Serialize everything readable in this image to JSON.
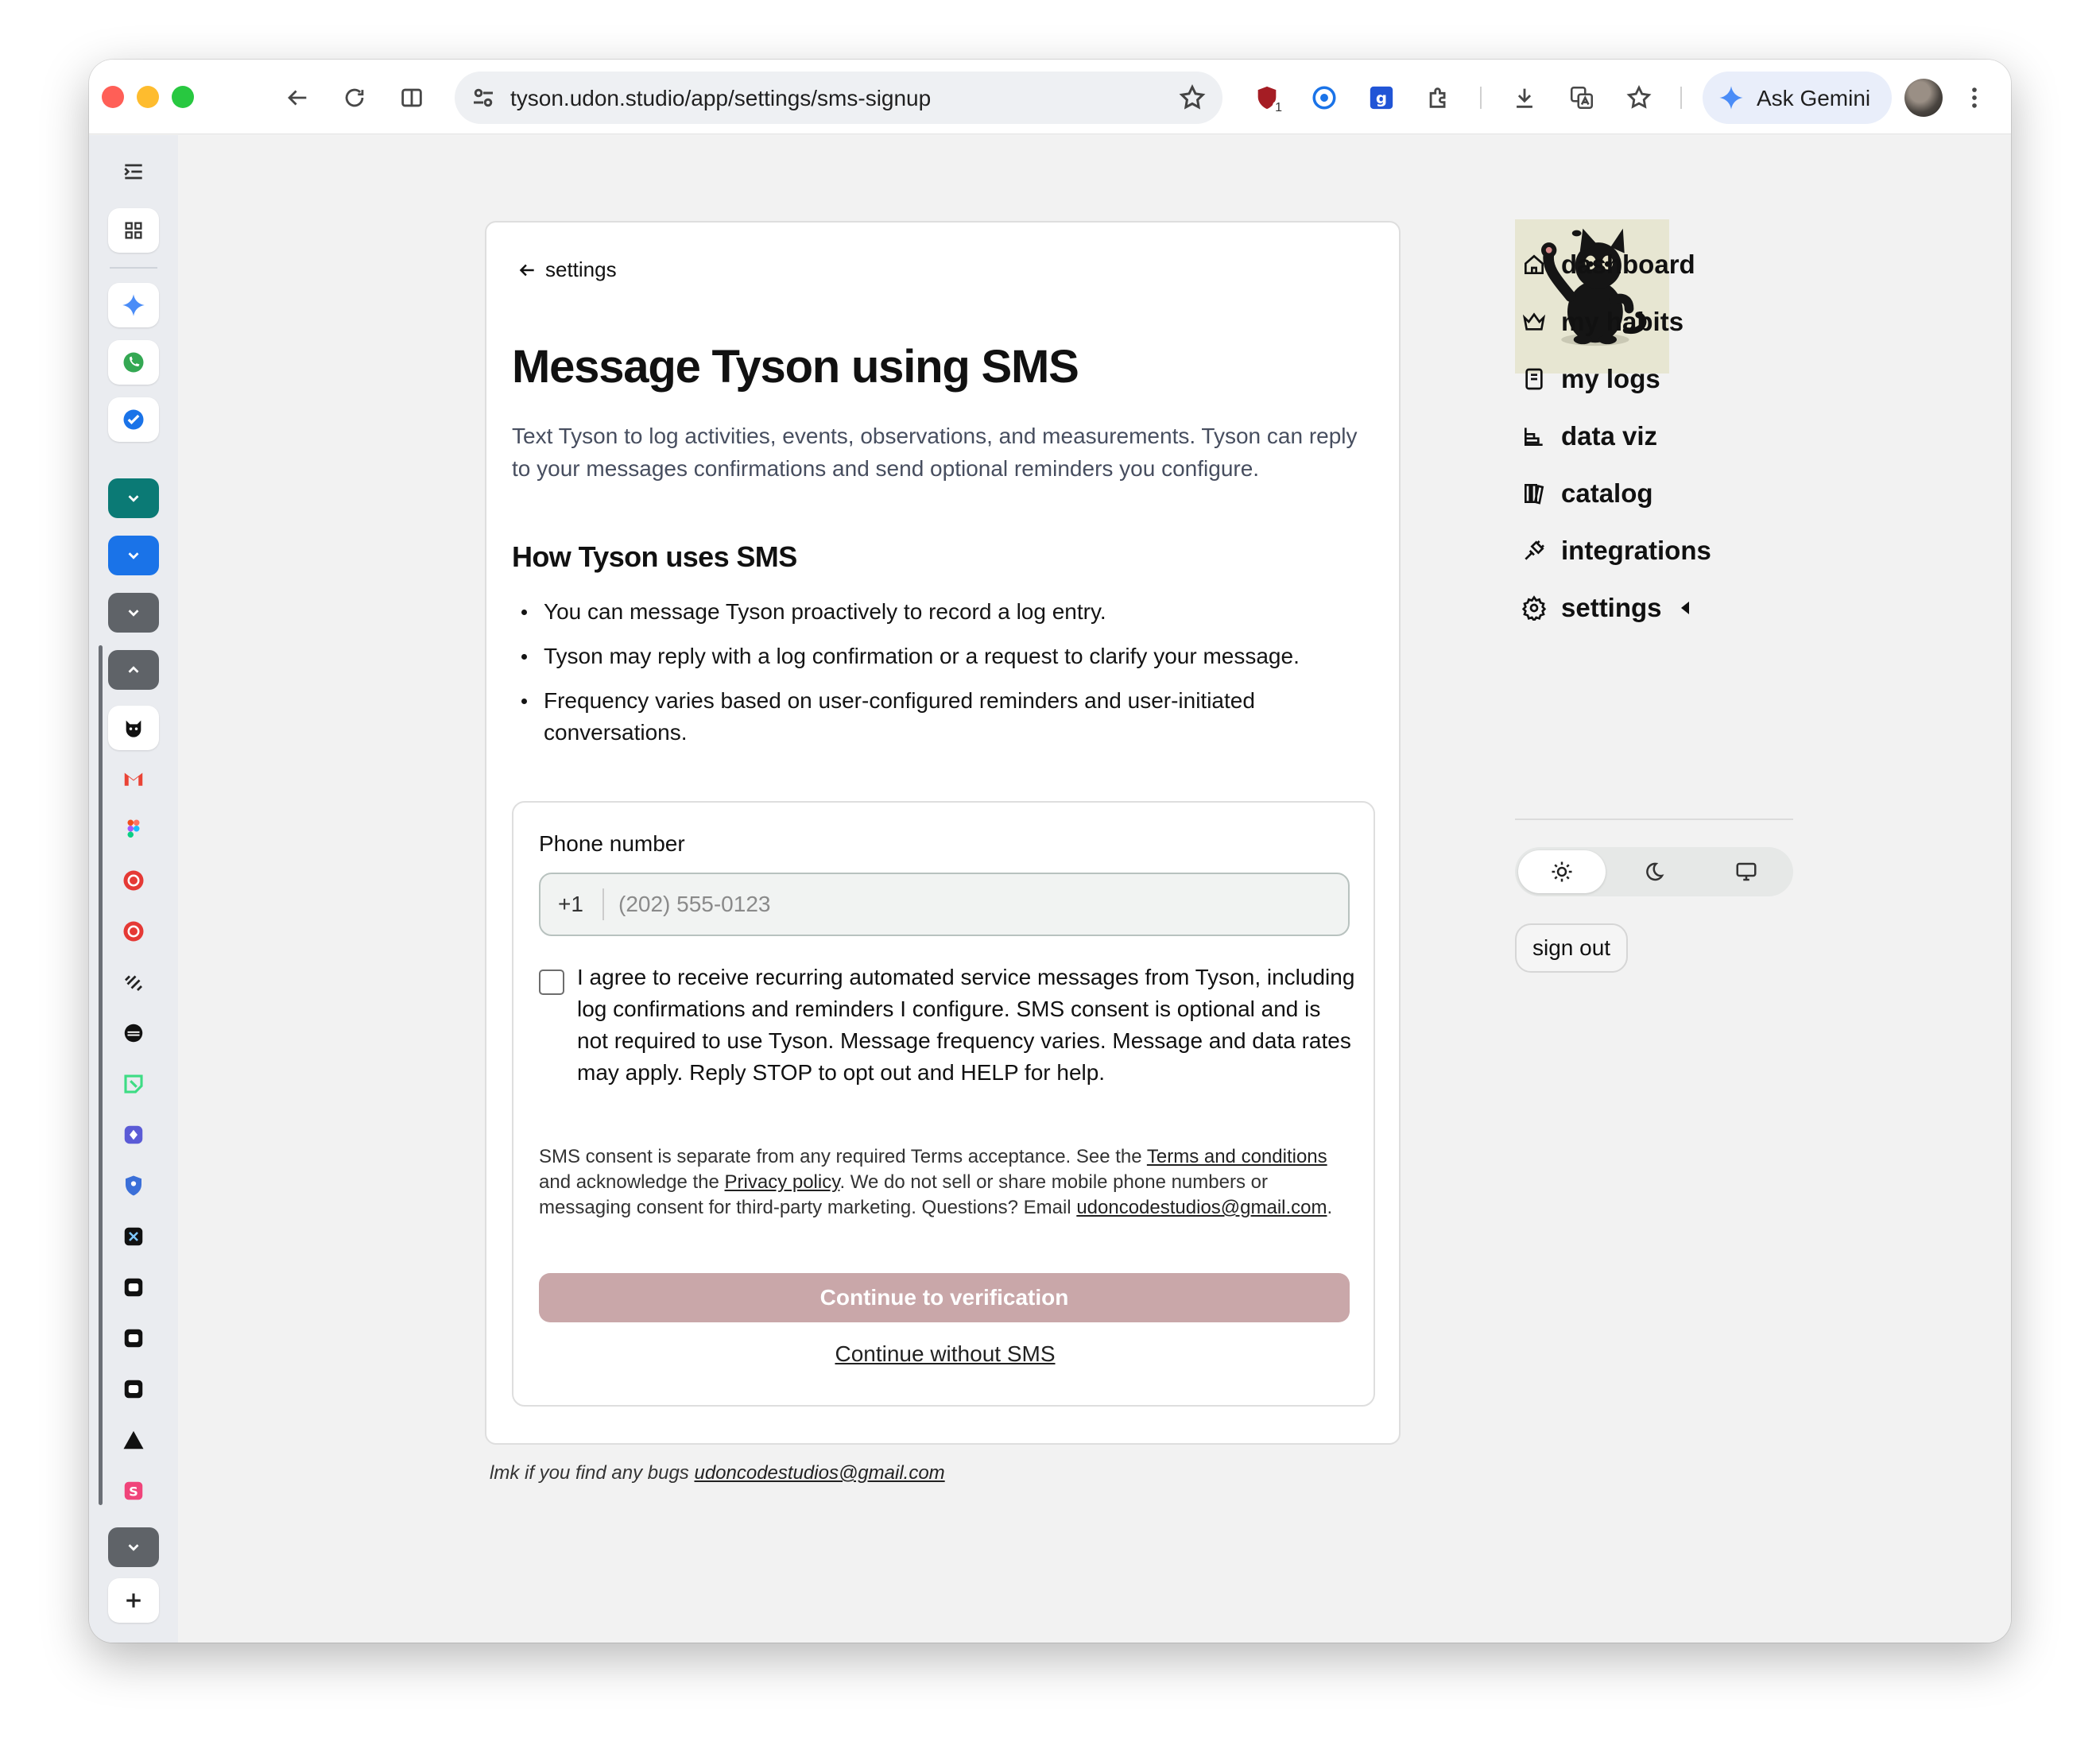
{
  "browser": {
    "url": "tyson.udon.studio/app/settings/sms-signup",
    "gemini_label": "Ask Gemini",
    "extension_badge": "1"
  },
  "page": {
    "back_label": "settings",
    "title": "Message Tyson using SMS",
    "intro": "Text Tyson to log activities, events, observations, and measurements. Tyson can reply to your messages confirmations and send optional reminders you configure.",
    "section_title": "How Tyson uses SMS",
    "bullets": [
      "You can message Tyson proactively to record a log entry.",
      "Tyson may reply with a log confirmation or a request to clarify your message.",
      "Frequency varies based on user-configured reminders and user-initiated conversations."
    ]
  },
  "form": {
    "phone_label": "Phone number",
    "country_code": "+1",
    "phone_placeholder": "(202) 555-0123",
    "phone_value": "",
    "consent_checked": false,
    "consent_text": "I agree to receive recurring automated service messages from Tyson, including log confirmations and reminders I configure. SMS consent is optional and is not required to use Tyson. Message frequency varies. Message and data rates may apply. Reply STOP to opt out and HELP for help.",
    "fine_print": {
      "part1": "SMS consent is separate from any required Terms acceptance. See the ",
      "terms_link": "Terms and conditions",
      "part2": " and acknowledge the ",
      "privacy_link": "Privacy policy",
      "part3": ". We do not sell or share mobile phone numbers or messaging consent for third-party marketing. Questions? Email ",
      "email_link": "udoncodestudios@gmail.com",
      "part4": "."
    },
    "continue_label": "Continue to verification",
    "skip_label": "Continue without SMS"
  },
  "footer": {
    "text": "lmk if you find any bugs ",
    "email": "udoncodestudios@gmail.com"
  },
  "sidebar": {
    "items": [
      {
        "label": "dashboard",
        "icon": "home-icon"
      },
      {
        "label": "my habits",
        "icon": "crown-icon"
      },
      {
        "label": "my logs",
        "icon": "notebook-icon"
      },
      {
        "label": "data viz",
        "icon": "bar-chart-icon"
      },
      {
        "label": "catalog",
        "icon": "library-icon"
      },
      {
        "label": "integrations",
        "icon": "plug-icon"
      },
      {
        "label": "settings",
        "icon": "gear-icon",
        "active": true
      }
    ],
    "theme_options": [
      "light",
      "dark",
      "system"
    ],
    "theme_selected": "light",
    "sign_out_label": "sign out"
  },
  "colors": {
    "primary_button": "#c9a7a9",
    "page_background": "#f2f2f2",
    "card_background": "#ffffff"
  }
}
